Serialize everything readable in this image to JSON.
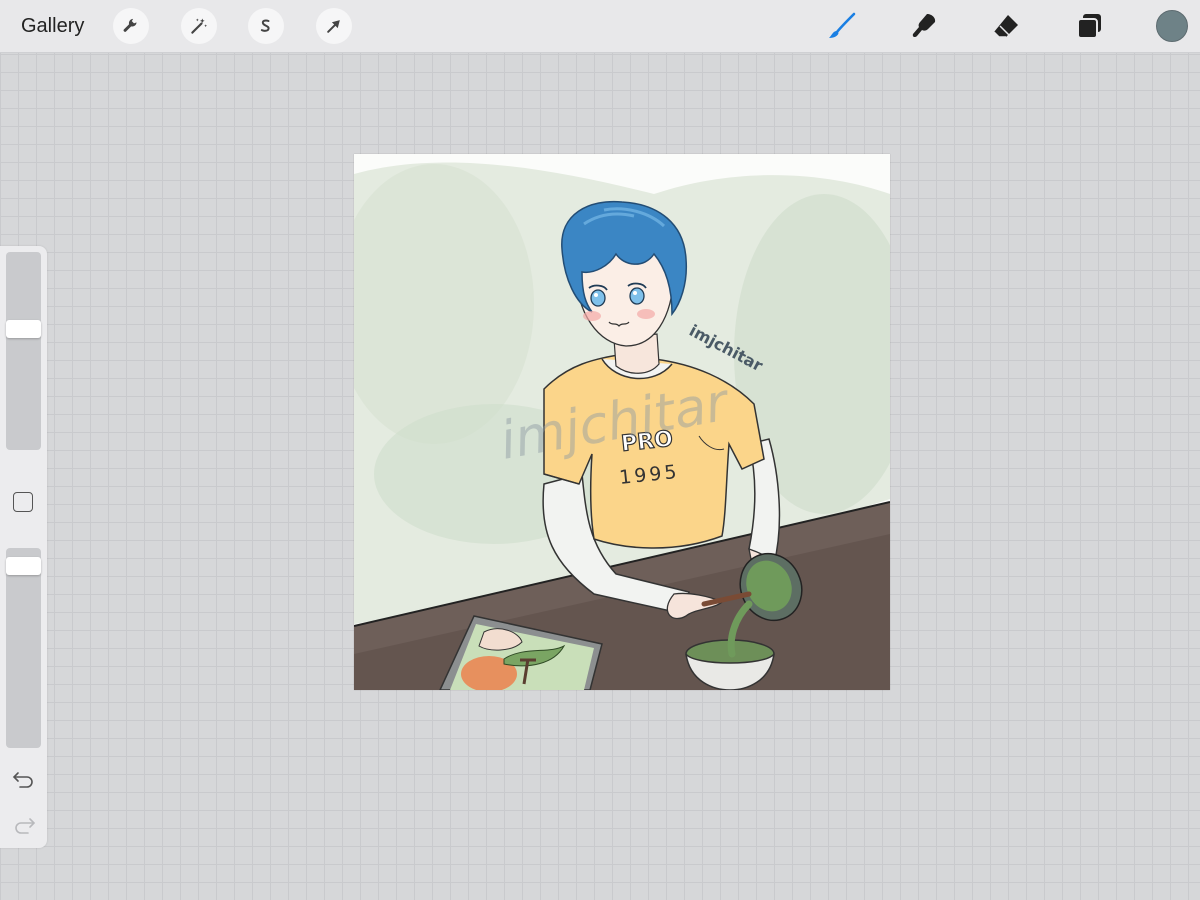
{
  "toolbar": {
    "gallery_label": "Gallery",
    "left_tools": [
      "wrench-icon",
      "magic-wand-icon",
      "selection-icon",
      "transform-arrow-icon"
    ],
    "right_tools": [
      "brush-icon",
      "smudge-icon",
      "eraser-icon",
      "layers-icon"
    ],
    "active_tool": "brush",
    "active_color": "#6e8287",
    "accent_color": "#1a7fe3"
  },
  "sidebar": {
    "brush_size_level": 0.62,
    "opacity_level": 0.95,
    "controls": [
      "modify-button",
      "undo-icon",
      "redo-icon"
    ]
  },
  "artwork": {
    "shirt_logo": "PRO",
    "shirt_number": "1995",
    "signature": "imjchitar",
    "watermark": "imjchitar"
  }
}
